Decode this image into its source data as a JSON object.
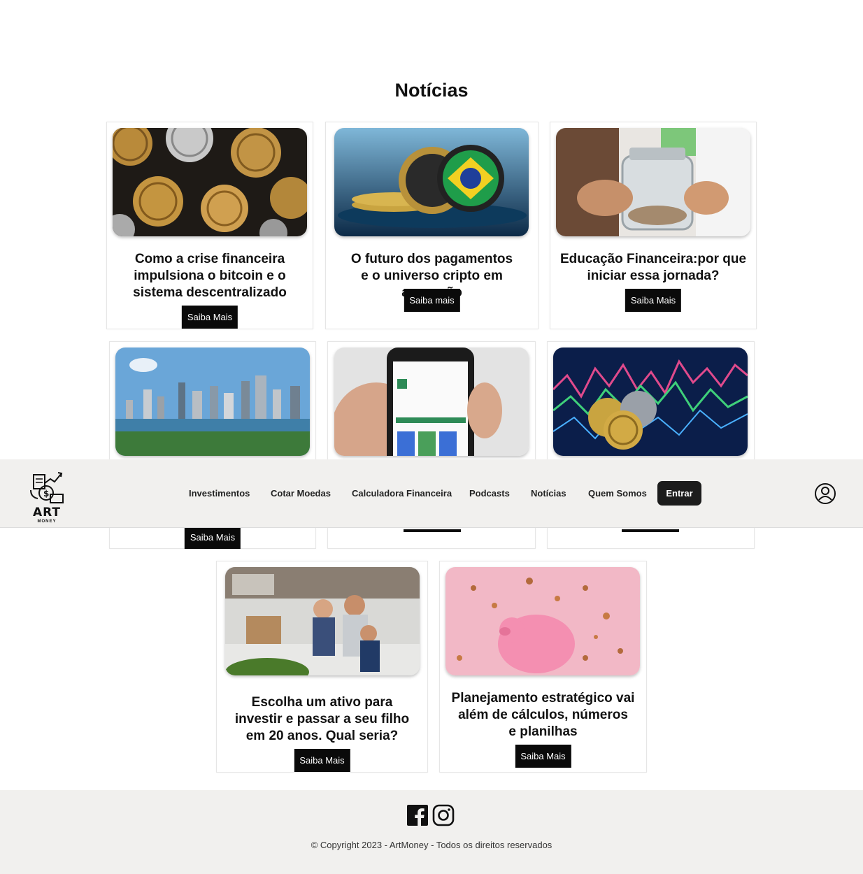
{
  "page": {
    "title": "Notícias"
  },
  "cards": [
    {
      "title": "Como a crise financeira\nimpulsiona o bitcoin e o\nsistema descentralizado",
      "button": "Saiba Mais"
    },
    {
      "title": "O futuro dos pagamentos\ne o universo cripto em ascensão",
      "button": "Saiba mais"
    },
    {
      "title": "Educação Financeira:por que\niniciar essa jornada?",
      "button": "Saiba Mais"
    },
    {
      "title": "",
      "button": "Saiba Mais"
    },
    {
      "title": "",
      "button": ""
    },
    {
      "title": "",
      "button": ""
    },
    {
      "title": "Escolha um ativo para\ninvestir e passar a seu filho\nem 20 anos. Qual seria?",
      "button": "Saiba Mais"
    },
    {
      "title": "Planejamento estratégico vai\nalém de cálculos, números\ne planilhas",
      "button": "Saiba Mais"
    }
  ],
  "nav": {
    "logo_text": "ART",
    "logo_sub": "MONEY",
    "items": [
      "Investimentos",
      "Cotar Moedas",
      "Calculadora Financeira",
      "Podcasts",
      "Notícias",
      "Quem Somos"
    ],
    "login_label": "Entrar",
    "user_icon": "user-circle-icon"
  },
  "footer": {
    "social_icons": [
      "facebook-icon",
      "instagram-icon"
    ],
    "copyright": "© Copyright 2023 - ArtMoney - Todos os direitos reservados"
  }
}
